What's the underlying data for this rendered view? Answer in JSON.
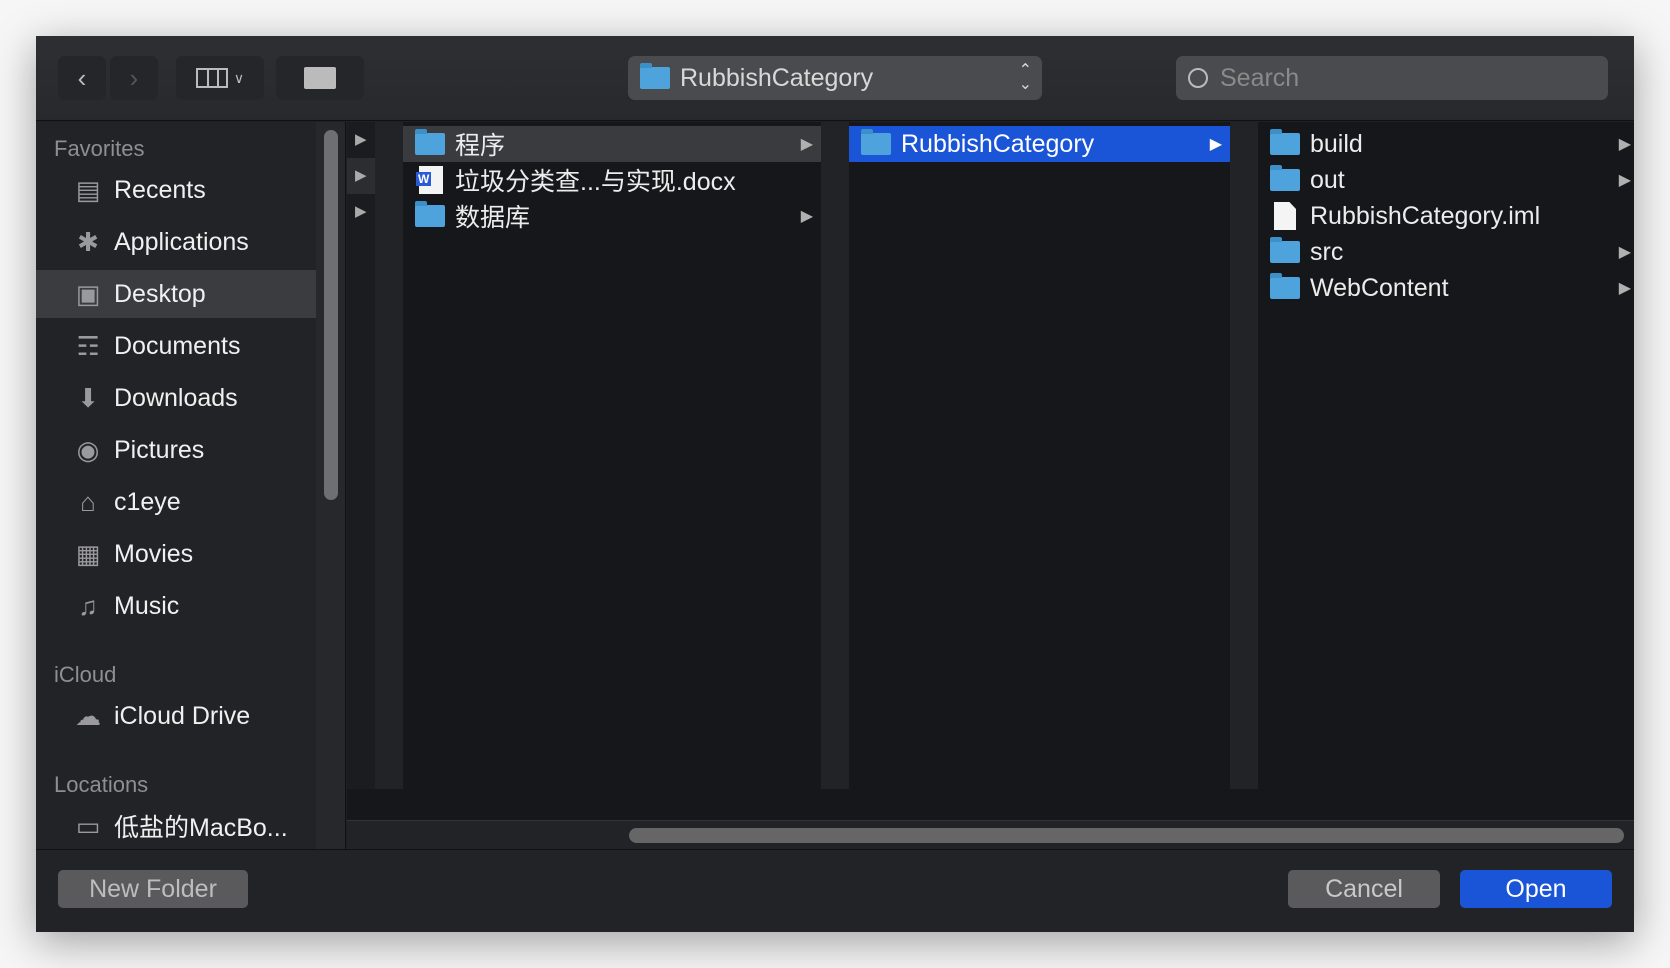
{
  "toolbar": {
    "back_icon": "chevron-left",
    "forward_icon": "chevron-right",
    "view_icon": "columns-view",
    "new_folder_icon": "folder-plus",
    "path": "RubbishCategory",
    "search_placeholder": "Search"
  },
  "sidebar": {
    "favorites_label": "Favorites",
    "favorites": [
      {
        "label": "Recents",
        "icon": "recents"
      },
      {
        "label": "Applications",
        "icon": "applications"
      },
      {
        "label": "Desktop",
        "icon": "desktop",
        "selected": true
      },
      {
        "label": "Documents",
        "icon": "documents"
      },
      {
        "label": "Downloads",
        "icon": "downloads"
      },
      {
        "label": "Pictures",
        "icon": "pictures"
      },
      {
        "label": "c1eye",
        "icon": "home"
      },
      {
        "label": "Movies",
        "icon": "movies"
      },
      {
        "label": "Music",
        "icon": "music"
      }
    ],
    "icloud_label": "iCloud",
    "icloud": [
      {
        "label": "iCloud Drive",
        "icon": "cloud"
      }
    ],
    "locations_label": "Locations",
    "locations": [
      {
        "label": "低盐的MacBo...",
        "icon": "laptop"
      }
    ]
  },
  "columns": [
    [
      {
        "name": "程序",
        "type": "folder",
        "highlighted": true
      },
      {
        "name": "垃圾分类查...与实现.docx",
        "type": "word"
      },
      {
        "name": "数据库",
        "type": "folder"
      }
    ],
    [
      {
        "name": "RubbishCategory",
        "type": "folder",
        "selected": true
      }
    ],
    [
      {
        "name": "build",
        "type": "folder"
      },
      {
        "name": "out",
        "type": "folder"
      },
      {
        "name": "RubbishCategory.iml",
        "type": "file"
      },
      {
        "name": "src",
        "type": "folder"
      },
      {
        "name": "WebContent",
        "type": "folder"
      }
    ]
  ],
  "footer": {
    "new_folder": "New Folder",
    "cancel": "Cancel",
    "open": "Open"
  },
  "colors": {
    "accent": "#1a55d8",
    "folder": "#4fa3dc"
  }
}
